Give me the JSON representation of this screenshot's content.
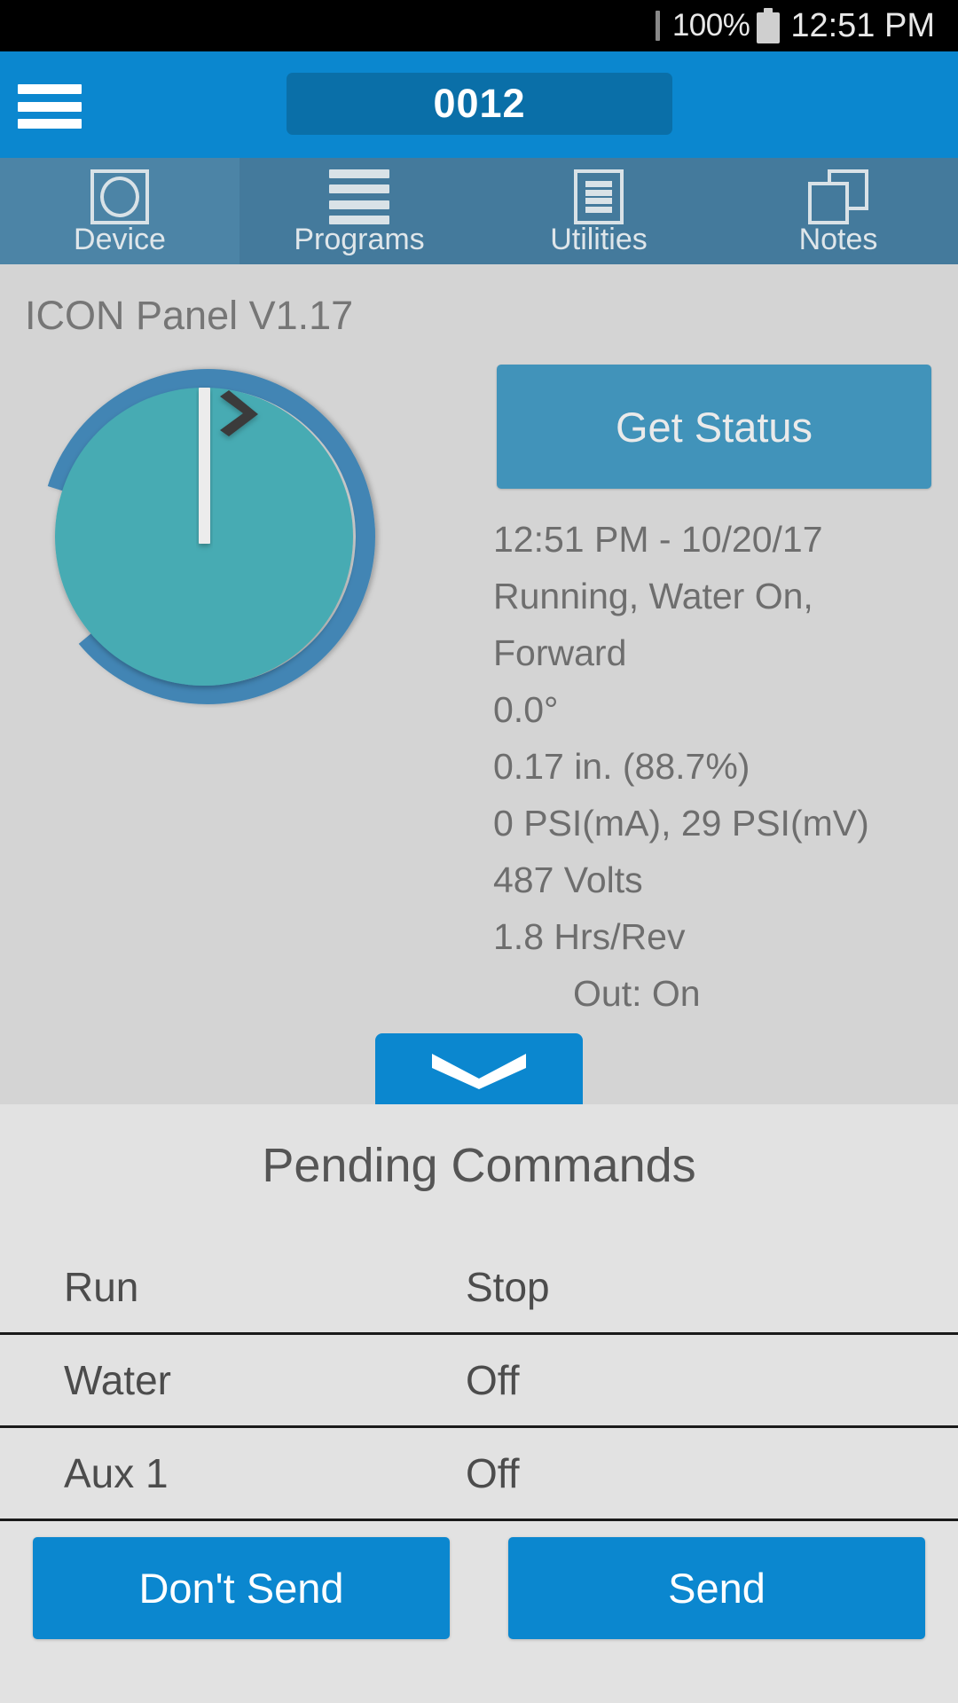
{
  "status_bar": {
    "battery_percent": "100%",
    "clock": "12:51 PM",
    "battery_icon": "battery-full-icon"
  },
  "app_bar": {
    "menu_icon": "hamburger-menu-icon",
    "device_id": "0012"
  },
  "tabs": [
    {
      "label": "Device",
      "icon": "device-circle-icon",
      "selected": true
    },
    {
      "label": "Programs",
      "icon": "list-lines-icon",
      "selected": false
    },
    {
      "label": "Utilities",
      "icon": "document-lines-icon",
      "selected": false
    },
    {
      "label": "Notes",
      "icon": "copy-pages-icon",
      "selected": false
    }
  ],
  "main": {
    "panel_version": "ICON Panel V1.17",
    "get_status_label": "Get Status",
    "gauge": {
      "icon": "pivot-position-gauge",
      "pointer_angle_deg": 0,
      "ring_gap_start_deg": 185,
      "ring_gap_end_deg": 352,
      "direction_icon": "chevron-right-icon",
      "ring_color": "#4285b4",
      "disc_color": "#46abb3"
    },
    "status_lines": [
      "12:51 PM - 10/20/17",
      "Running, Water On,",
      "Forward",
      "0.0°",
      "0.17 in. (88.7%)",
      "0 PSI(mA), 29 PSI(mV)",
      "487 Volts",
      "1.8 Hrs/Rev",
      "Out: On"
    ],
    "expand_icon": "chevron-down-icon"
  },
  "pending": {
    "title": "Pending Commands",
    "rows": [
      {
        "name": "Run",
        "value": "Stop"
      },
      {
        "name": "Water",
        "value": "Off"
      },
      {
        "name": "Aux 1",
        "value": "Off"
      }
    ],
    "dont_send_label": "Don't Send",
    "send_label": "Send"
  },
  "colors": {
    "app_bar_blue": "#0b87cf",
    "app_bar_pill": "#0a6fa8",
    "tab_bar": "#447a9c",
    "tab_selected": "#4c84a6",
    "content_bg": "#d4d4d4",
    "pending_bg": "#e2e2e2",
    "get_status_blue": "#4193ba",
    "gauge_ring": "#4285b4",
    "gauge_disc": "#46abb3",
    "text_gray": "#6e6e6e"
  }
}
